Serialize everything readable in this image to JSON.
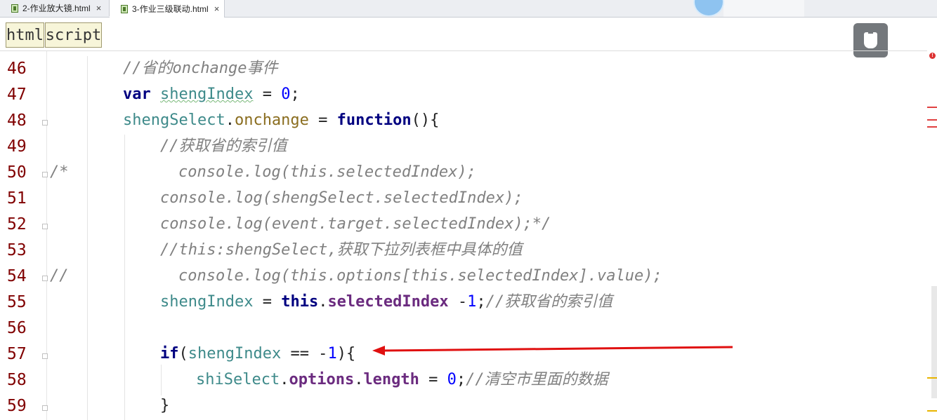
{
  "tabs": [
    {
      "label": "2-作业放大镜.html",
      "close": "×",
      "icon": "html-file-icon"
    },
    {
      "label": "3-作业三级联动.html",
      "close": "×",
      "icon": "html-file-icon"
    }
  ],
  "breadcrumb": [
    "html",
    "script"
  ],
  "lines": {
    "46": {
      "num": "46",
      "comment": "//省的onchange事件"
    },
    "47": {
      "num": "47",
      "kw": "var",
      "name": "shengIndex",
      "eq": " = ",
      "val": "0",
      "end": ";"
    },
    "48": {
      "num": "48",
      "obj": "shengSelect",
      "dot": ".",
      "prop": "onchange",
      "eq": " = ",
      "fn": "function",
      "end": "(){"
    },
    "49": {
      "num": "49",
      "comment": "//获取省的索引值"
    },
    "50": {
      "num": "50",
      "prefix": "/*",
      "code": "console.log(this.selectedIndex);"
    },
    "51": {
      "num": "51",
      "code": "console.log(shengSelect.selectedIndex);"
    },
    "52": {
      "num": "52",
      "code": "console.log(event.target.selectedIndex);*/"
    },
    "53": {
      "num": "53",
      "comment": "//this:shengSelect,获取下拉列表框中具体的值"
    },
    "54": {
      "num": "54",
      "prefix": "//",
      "code": "console.log(this.options[this.selectedIndex].value);"
    },
    "55": {
      "num": "55",
      "name": "shengIndex",
      "eq": " = ",
      "this": "this",
      "dot": ".",
      "prop": "selectedIndex",
      "op": " -",
      "val": "1",
      "semi": ";",
      "comment": "//获取省的索引值"
    },
    "56": {
      "num": "56"
    },
    "57": {
      "num": "57",
      "kw": "if",
      "open": "(",
      "name": "shengIndex",
      "op": " == -",
      "val": "1",
      "close": "){"
    },
    "58": {
      "num": "58",
      "obj": "shiSelect",
      "dot1": ".",
      "prop1": "options",
      "dot2": ".",
      "prop2": "length",
      "eq": " = ",
      "val": "0",
      "semi": ";",
      "comment": "//清空市里面的数据"
    },
    "59": {
      "num": "59",
      "code": "}"
    }
  },
  "colors": {
    "line_number": "#800000",
    "comment": "#808080",
    "keyword": "#000080",
    "identifier": "#3e8a8a",
    "property": "#6b2b7f",
    "number": "#0000ff",
    "annotation_arrow": "#e01010"
  }
}
